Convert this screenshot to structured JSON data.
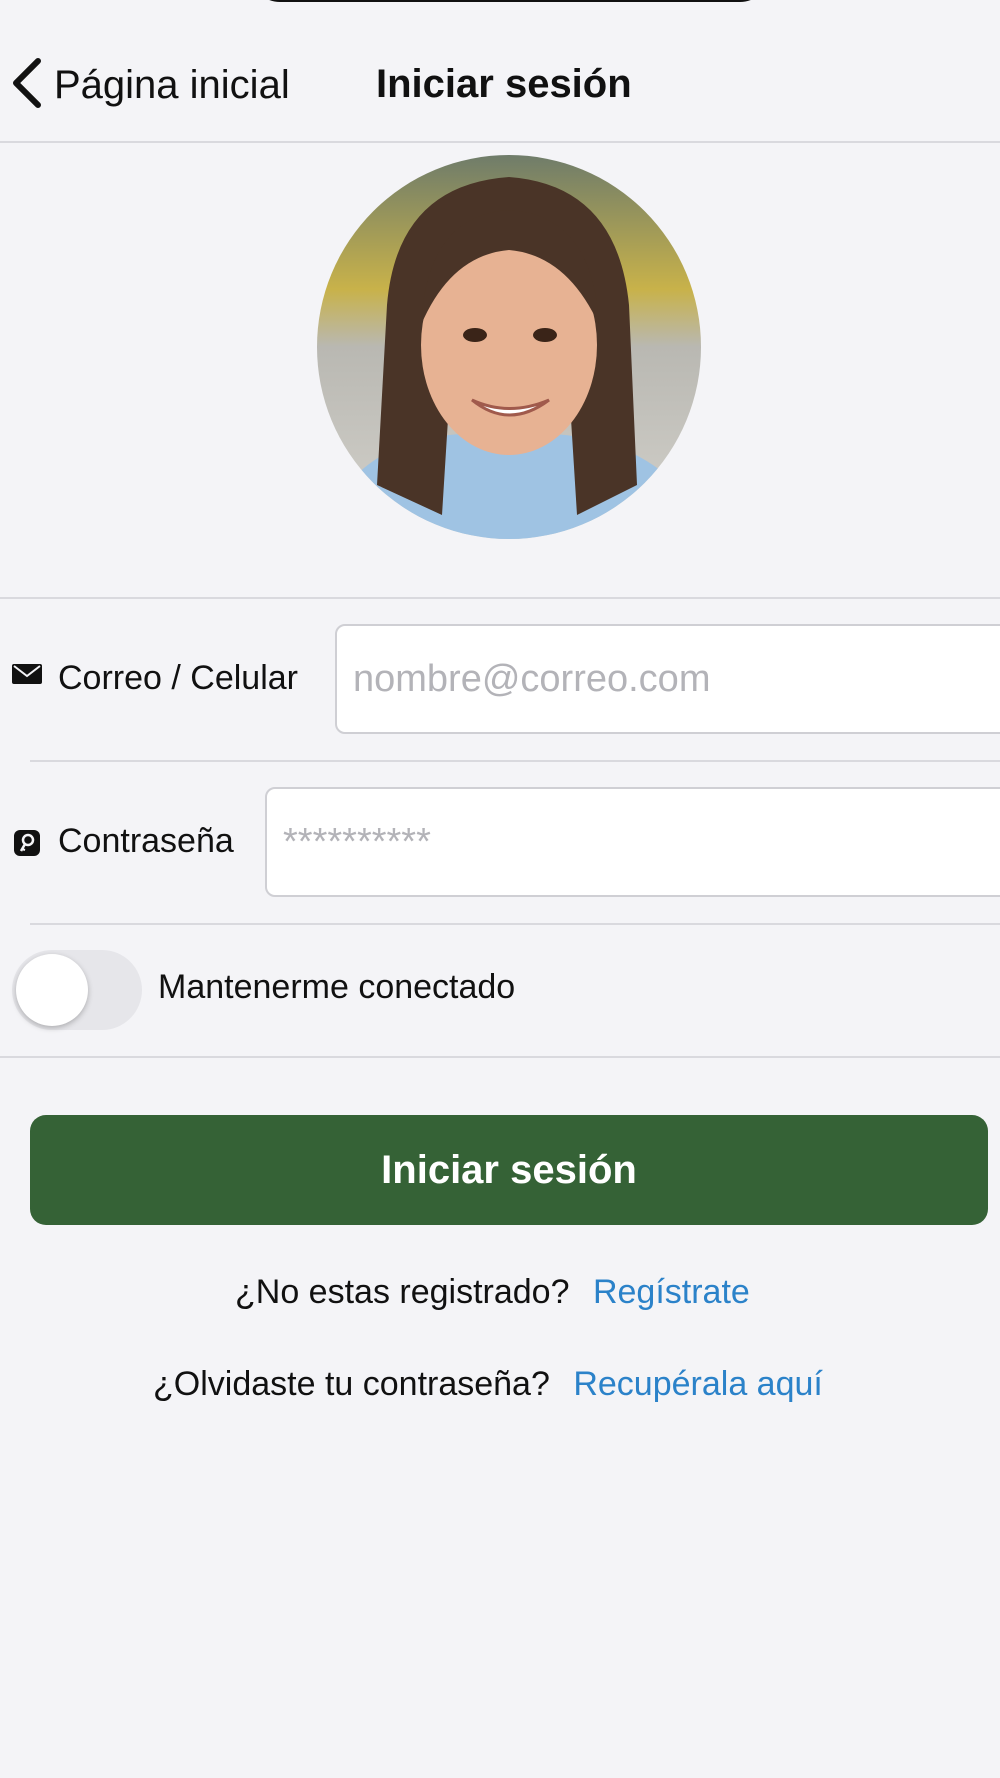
{
  "navbar": {
    "back_label": "Página inicial",
    "title": "Iniciar sesión"
  },
  "login_form": {
    "email_label": "Correo / Celular",
    "email_placeholder": "nombre@correo.com",
    "email_value": "",
    "password_label": "Contraseña",
    "password_placeholder": "**********",
    "password_value": "",
    "remember_label": "Mantenerme conectado",
    "remember_on": false,
    "submit_label": "Iniciar sesión"
  },
  "footer_links": {
    "register_prompt": "¿No estas registrado?",
    "register_link": "Regístrate",
    "forgot_prompt": "¿Olvidaste tu contraseña?",
    "forgot_link": "Recupérala aquí"
  },
  "colors": {
    "background": "#f4f4f7",
    "primary_button": "#356236",
    "link": "#2b82c9"
  },
  "icons": {
    "back": "chevron-left-icon",
    "email": "envelope-icon",
    "password": "key-icon"
  }
}
